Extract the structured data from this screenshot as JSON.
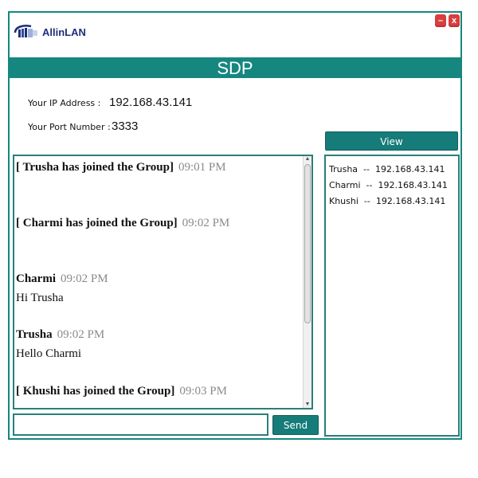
{
  "app": {
    "logo_text": "AllinLAN",
    "title": "SDP",
    "window_controls": {
      "minimize": "–",
      "close": "x"
    }
  },
  "info": {
    "ip_label": "Your IP Address :",
    "ip_value": "192.168.43.141",
    "port_label": "Your Port Number :",
    "port_value": "3333"
  },
  "chat": {
    "messages": [
      {
        "type": "system",
        "text": "[ Trusha has joined the Group]",
        "time": "09:01 PM"
      },
      {
        "type": "system",
        "text": "[ Charmi has joined the Group]",
        "time": "09:02 PM"
      },
      {
        "type": "message",
        "name": "Charmi",
        "time": "09:02 PM",
        "text": "Hi Trusha"
      },
      {
        "type": "message",
        "name": "Trusha",
        "time": "09:02 PM",
        "text": "Hello Charmi"
      },
      {
        "type": "system",
        "text": "[ Khushi has joined the Group]",
        "time": "09:03 PM"
      }
    ]
  },
  "view_button": "View",
  "users": [
    {
      "name": "Trusha",
      "separator": "--",
      "ip": "192.168.43.141"
    },
    {
      "name": "Charmi",
      "separator": "--",
      "ip": "192.168.43.141"
    },
    {
      "name": "Khushi",
      "separator": "--",
      "ip": "192.168.43.141"
    }
  ],
  "input": {
    "value": "",
    "placeholder": ""
  },
  "send_button": "Send",
  "colors": {
    "accent": "#15877f",
    "logo_text": "#1d2f7a",
    "close_button": "#d93e3e"
  },
  "icons": {
    "logo": "allinlan-cable-icon",
    "minimize": "minimize-icon",
    "close": "close-icon"
  }
}
